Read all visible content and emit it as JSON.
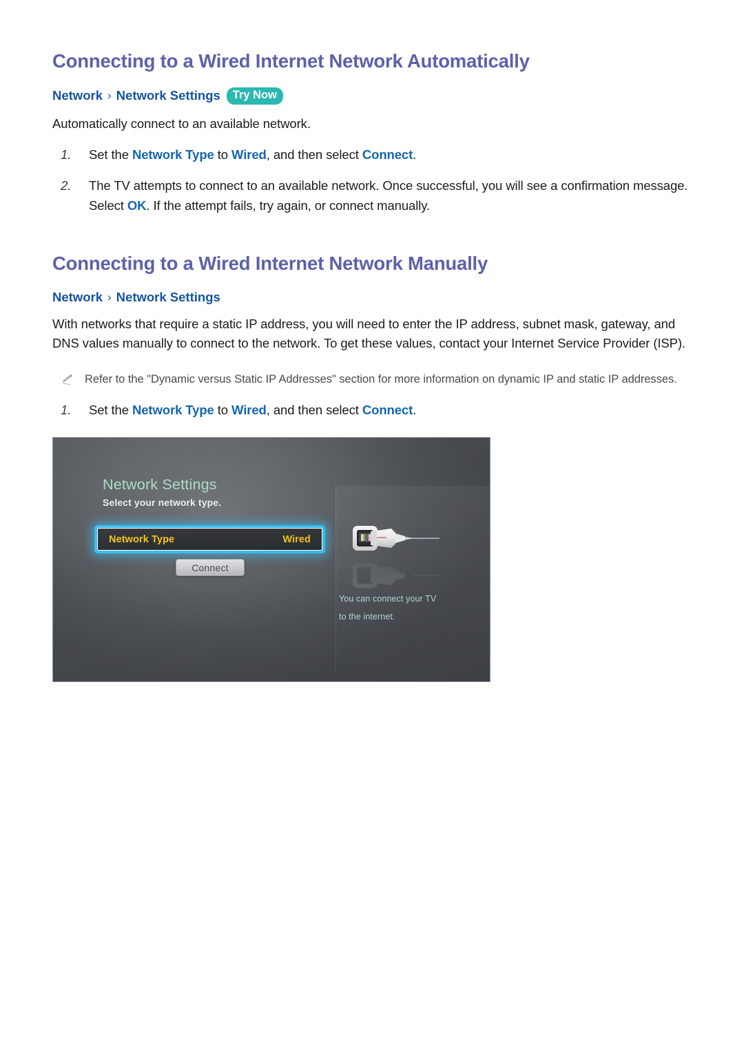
{
  "document": {
    "sections": [
      {
        "id": "auto",
        "title": "Connecting to a Wired Internet Network Automatically",
        "breadcrumb": {
          "crumb1": "Network",
          "separator": "›",
          "crumb2": "Network Settings",
          "badge": "Try Now"
        },
        "lead": "Automatically connect to an available network.",
        "steps": [
          {
            "num": "1.",
            "parts": [
              {
                "t": "Set the ",
                "kw": false
              },
              {
                "t": "Network Type",
                "kw": true
              },
              {
                "t": " to ",
                "kw": false
              },
              {
                "t": "Wired",
                "kw": true
              },
              {
                "t": ", and then select ",
                "kw": false
              },
              {
                "t": "Connect",
                "kw": true
              },
              {
                "t": ".",
                "kw": false
              }
            ]
          },
          {
            "num": "2.",
            "parts": [
              {
                "t": "The TV attempts to connect to an available network. Once successful, you will see a confirmation message. Select ",
                "kw": false
              },
              {
                "t": "OK",
                "kw": true
              },
              {
                "t": ". If the attempt fails, try again, or connect manually.",
                "kw": false
              }
            ]
          }
        ]
      },
      {
        "id": "manual",
        "title": "Connecting to a Wired Internet Network Manually",
        "breadcrumb": {
          "crumb1": "Network",
          "separator": "›",
          "crumb2": "Network Settings"
        },
        "paragraph": "With networks that require a static IP address, you will need to enter the IP address, subnet mask, gateway, and DNS values manually to connect to the network. To get these values, contact your Internet Service Provider (ISP).",
        "note": {
          "icon": "pencil-icon",
          "text": "Refer to the \"Dynamic versus Static IP Addresses\" section for more information on dynamic IP and static IP addresses."
        },
        "steps": [
          {
            "num": "1.",
            "parts": [
              {
                "t": "Set the ",
                "kw": false
              },
              {
                "t": "Network Type",
                "kw": true
              },
              {
                "t": " to ",
                "kw": false
              },
              {
                "t": "Wired",
                "kw": true
              },
              {
                "t": ", and then select ",
                "kw": false
              },
              {
                "t": "Connect",
                "kw": true
              },
              {
                "t": ".",
                "kw": false
              }
            ]
          }
        ]
      }
    ]
  },
  "tv_screen": {
    "title": "Network Settings",
    "subtitle": "Select your network type.",
    "option_row": {
      "label": "Network Type",
      "value": "Wired"
    },
    "connect_button": "Connect",
    "side_caption_line1": "You can connect your TV",
    "side_caption_line2": "to the internet.",
    "illustration": "lan-port-cable-icon"
  },
  "colors": {
    "heading": "#5d61a8",
    "breadcrumb": "#15549e",
    "keyword_link": "#1466ae",
    "try_now_badge": "#2ab9b2",
    "tv_title_green": "#a9dcc2",
    "tv_highlight_blue": "#3bbdf0",
    "tv_value_yellow": "#f5c518",
    "tv_caption_cyan": "#bcdfe2",
    "page_background": "#ffffff"
  }
}
